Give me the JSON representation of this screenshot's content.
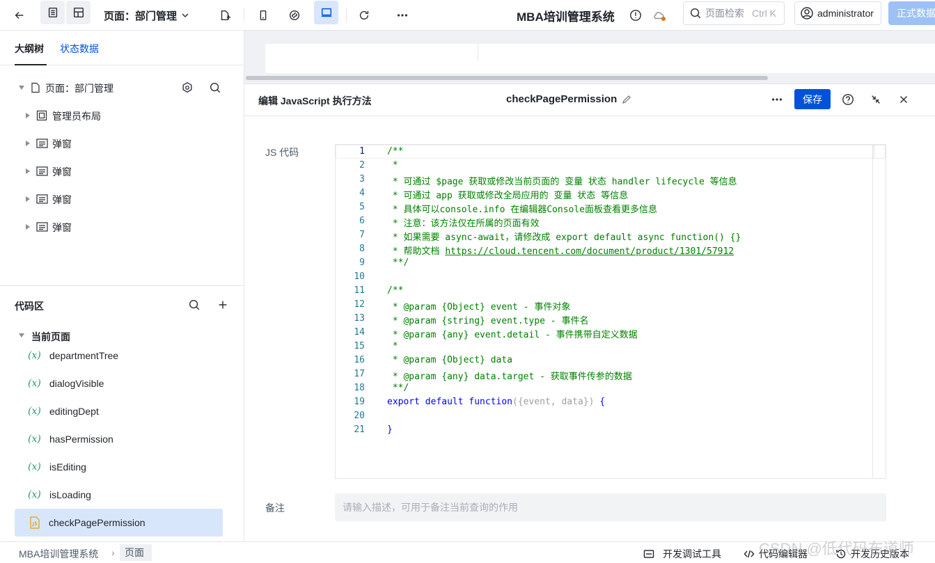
{
  "topbar": {
    "page_selector": "页面：部门管理",
    "app_title": "MBA培训管理系统",
    "search_placeholder": "页面检索",
    "search_shortcut": "Ctrl K",
    "user_name": "administrator",
    "publish_label": "正式数据"
  },
  "sidebar": {
    "tabs": [
      "大纲树",
      "状态数据"
    ],
    "tree": [
      {
        "label": "页面：部门管理",
        "icon": "page-icon",
        "level": 0
      },
      {
        "label": "管理员布局",
        "icon": "layout-icon",
        "level": 1
      },
      {
        "label": "弹窗",
        "icon": "dialog-icon",
        "level": 1
      },
      {
        "label": "弹窗",
        "icon": "dialog-icon",
        "level": 1
      },
      {
        "label": "弹窗",
        "icon": "dialog-icon",
        "level": 1
      },
      {
        "label": "弹窗",
        "icon": "dialog-icon",
        "level": 1
      }
    ],
    "code_area_title": "代码区",
    "current_page_label": "当前页面",
    "code_items": [
      {
        "label": "departmentTree",
        "icon": "variable-icon"
      },
      {
        "label": "dialogVisible",
        "icon": "variable-icon"
      },
      {
        "label": "editingDept",
        "icon": "variable-icon"
      },
      {
        "label": "hasPermission",
        "icon": "variable-icon"
      },
      {
        "label": "isEditing",
        "icon": "variable-icon"
      },
      {
        "label": "isLoading",
        "icon": "variable-icon"
      },
      {
        "label": "checkPagePermission",
        "icon": "js-file-icon",
        "active": true
      }
    ]
  },
  "editor_panel": {
    "title": "编辑 JavaScript 执行方法",
    "method_name": "checkPagePermission",
    "save_label": "保存",
    "js_label": "JS 代码",
    "remark_label": "备注",
    "remark_placeholder": "请输入描述，可用于备注当前查询的作用",
    "code_lines": [
      "/**",
      " *",
      " * 可通过 $page 获取或修改当前页面的 变量 状态 handler lifecycle 等信息",
      " * 可通过 app 获取或修改全局应用的 变量 状态 等信息",
      " * 具体可以console.info 在编辑器Console面板查看更多信息",
      " * 注意：该方法仅在所属的页面有效",
      " * 如果需要 async-await，请修改成 export default async function() {}",
      " * 帮助文档 https://cloud.tencent.com/document/product/1301/57912",
      " **/",
      "",
      "/**",
      " * @param {Object} event - 事件对象",
      " * @param {string} event.type - 事件名",
      " * @param {any} event.detail - 事件携带自定义数据",
      " *",
      " * @param {Object} data",
      " * @param {any} data.target - 获取事件传参的数据",
      " **/",
      "export default function({event, data}) {",
      "",
      "}"
    ],
    "line_numbers": [
      "1",
      "2",
      "3",
      "4",
      "5",
      "6",
      "7",
      "8",
      "9",
      "10",
      "11",
      "12",
      "13",
      "14",
      "15",
      "16",
      "17",
      "18",
      "19",
      "20",
      "21"
    ]
  },
  "bottombar": {
    "breadcrumb": [
      "MBA培训管理系统",
      "页面"
    ],
    "dev_tools_label": "开发调试工具",
    "code_editor_label": "代码编辑器",
    "history_label": "开发历史版本"
  },
  "watermark": "CSDN @低代码布道师"
}
